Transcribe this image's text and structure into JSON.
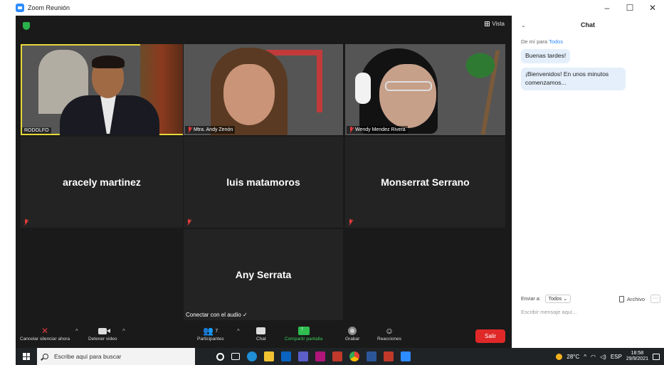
{
  "window": {
    "title": "Zoom Reunión",
    "controls": [
      "–",
      "☐",
      "✕"
    ]
  },
  "meeting": {
    "view_label": "Vista",
    "tiles": [
      {
        "name": "RODOLFO"
      },
      {
        "name": "Mtra. Andy Zenón"
      },
      {
        "name": "Wendy Mendez Rivera"
      },
      {
        "name": "aracely martinez"
      },
      {
        "name": "luis matamoros"
      },
      {
        "name": "Monserrat Serrano"
      },
      {
        "name": "Any Serrata",
        "audio_link": "Conectar con el audio ✓"
      }
    ]
  },
  "toolbar": {
    "mute": "Cancelar silenciar ahora",
    "video": "Detener video",
    "participants": "Participantes",
    "participants_count": "7",
    "chat": "Chat",
    "share": "Compartir pantalla",
    "record": "Grabar",
    "reactions": "Reacciones",
    "leave": "Salir"
  },
  "chat": {
    "title": "Chat",
    "from_prefix": "De mí para",
    "from_to": "Todos",
    "messages": [
      "Buenas tardes!",
      "¡Bienvenidos! En unos minutos comenzamos..."
    ],
    "send_to_label": "Enviar a:",
    "send_to_value": "Todos ⌄",
    "file_label": "Archivo",
    "more_label": "···",
    "placeholder": "Escribir mensaje aquí..."
  },
  "taskbar": {
    "search_placeholder": "Escribe aquí para buscar",
    "weather": "28°C",
    "lang": "ESP",
    "time": "18:58",
    "date": "29/9/2021"
  }
}
